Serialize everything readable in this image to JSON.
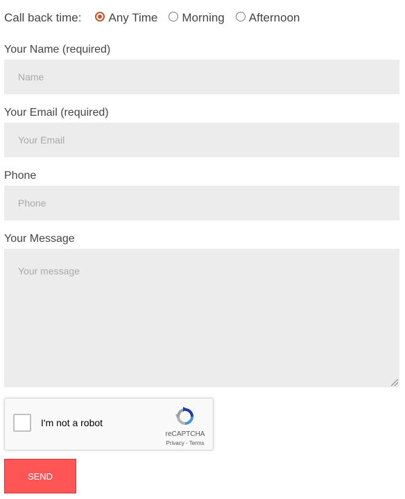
{
  "callback": {
    "label": "Call back time:",
    "options": [
      {
        "label": "Any Time",
        "checked": true
      },
      {
        "label": "Morning",
        "checked": false
      },
      {
        "label": "Afternoon",
        "checked": false
      }
    ]
  },
  "fields": {
    "name": {
      "label": "Your Name (required)",
      "placeholder": "Name",
      "value": ""
    },
    "email": {
      "label": "Your Email (required)",
      "placeholder": "Your Email",
      "value": ""
    },
    "phone": {
      "label": "Phone",
      "placeholder": "Phone",
      "value": ""
    },
    "message": {
      "label": "Your Message",
      "placeholder": "Your message",
      "value": ""
    }
  },
  "recaptcha": {
    "label": "I'm not a robot",
    "brand": "reCAPTCHA",
    "privacy": "Privacy",
    "separator": " - ",
    "terms": "Terms"
  },
  "send": {
    "label": "SEND"
  },
  "colors": {
    "radio_accent": "#c9542e",
    "field_bg": "#ececec",
    "send_bg": "#ff5555"
  }
}
